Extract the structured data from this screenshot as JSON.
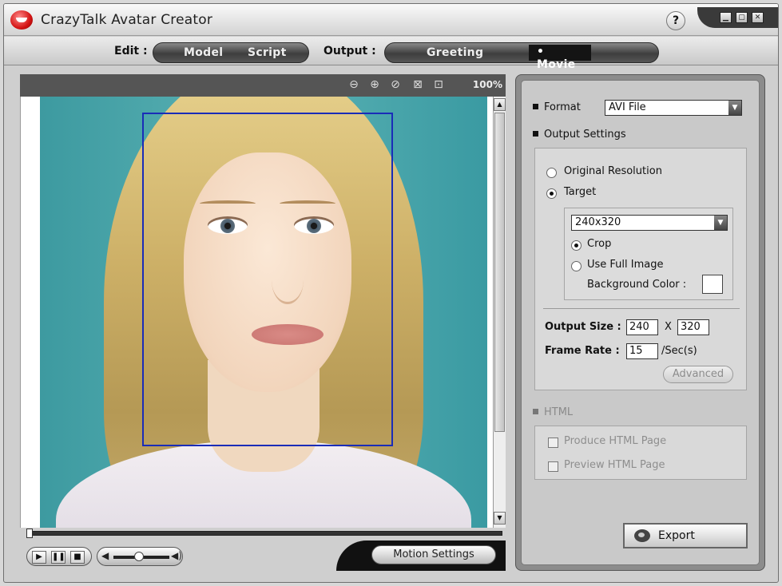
{
  "window": {
    "title": "CrazyTalk Avatar Creator",
    "help": "?",
    "controls": [
      "▁",
      "▢",
      "✕"
    ]
  },
  "modebar": {
    "edit_label": "Edit :",
    "edit_tabs": [
      "Model",
      "Script"
    ],
    "output_label": "Output :",
    "output_tabs": [
      "Greeting",
      "Movie"
    ],
    "active_tab": "Movie"
  },
  "viewer": {
    "zoom": "100%",
    "toolbar_icons": [
      "zoom-out-icon",
      "zoom-in-icon",
      "reset-icon",
      "fit-icon",
      "actual-size-icon"
    ],
    "motion_settings": "Motion Settings"
  },
  "panel": {
    "format_label": "Format",
    "format_value": "AVI File",
    "output_settings_label": "Output Settings",
    "original_resolution": "Original Resolution",
    "target": "Target",
    "target_value": "240x320",
    "crop": "Crop",
    "use_full_image": "Use Full Image",
    "background_color": "Background Color :",
    "output_size_label": "Output Size :",
    "output_width": "240",
    "size_x": "X",
    "output_height": "320",
    "frame_rate_label": "Frame Rate :",
    "frame_rate_value": "15",
    "frame_rate_unit": "/Sec(s)",
    "advanced": "Advanced",
    "html_label": "HTML",
    "produce_html": "Produce HTML Page",
    "preview_html": "Preview HTML Page",
    "export": "Export"
  }
}
